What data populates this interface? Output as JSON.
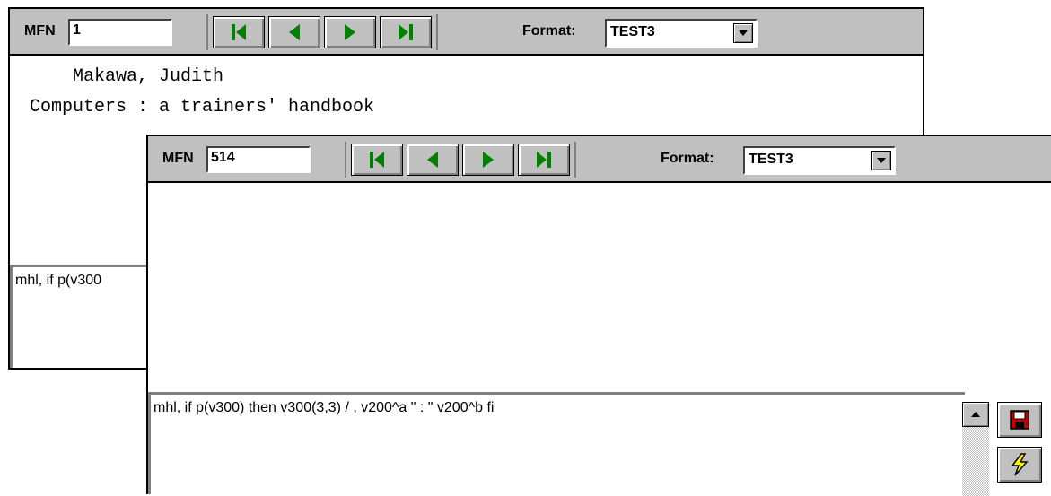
{
  "back_window": {
    "mfn_label": "MFN",
    "mfn_value": "1",
    "format_label": "Format:",
    "format_value": "TEST3",
    "display_lines": [
      "    Makawa, Judith",
      "Computers : a trainers' handbook"
    ],
    "format_text": "mhl, if p(v300"
  },
  "front_window": {
    "mfn_label": "MFN",
    "mfn_value": "514",
    "format_label": "Format:",
    "format_value": "TEST3",
    "format_text": "mhl, if p(v300) then v300(3,3) / , v200^a \" : \" v200^b fi"
  },
  "icons": {
    "first": "first-record-icon",
    "prev": "previous-record-icon",
    "next": "next-record-icon",
    "last": "last-record-icon",
    "save": "save-disk-icon",
    "run": "lightning-icon"
  },
  "colors": {
    "toolbar": "#c0c0c0",
    "nav_arrow": "#008000",
    "save_icon": "#c00000",
    "run_icon": "#ffff00"
  }
}
